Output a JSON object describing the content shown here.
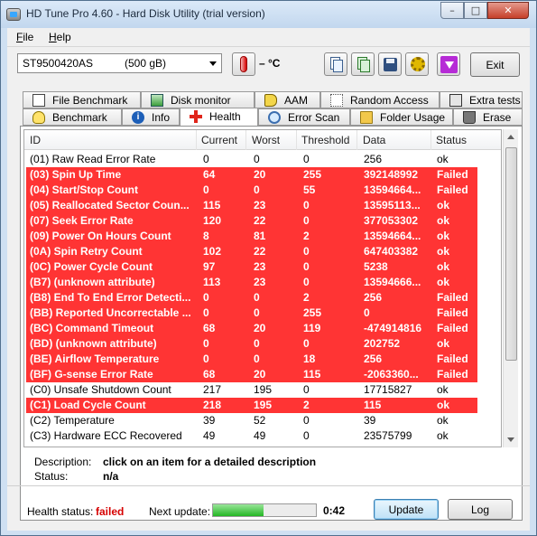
{
  "window": {
    "title": "HD Tune Pro 4.60 - Hard Disk Utility (trial version)",
    "minimize": "–",
    "maximize": "□",
    "close": "✕"
  },
  "menu": [
    {
      "accel": "F",
      "rest": "ile"
    },
    {
      "accel": "H",
      "rest": "elp"
    }
  ],
  "toolbar": {
    "drive_model": "ST9500420AS",
    "drive_size": "(500 gB)",
    "temperature": "– °C",
    "exit_label": "Exit"
  },
  "tabs_top": [
    "File Benchmark",
    "Disk monitor",
    "AAM",
    "Random Access",
    "Extra tests"
  ],
  "tabs_bottom": [
    "Benchmark",
    "Info",
    "Health",
    "Error Scan",
    "Folder Usage",
    "Erase"
  ],
  "active_tab": "Health",
  "table": {
    "columns": [
      "ID",
      "Current",
      "Worst",
      "Threshold",
      "Data",
      "Status"
    ],
    "rows": [
      {
        "id": "(01) Raw Read Error Rate",
        "current": "0",
        "worst": "0",
        "threshold": "0",
        "data": "256",
        "status": "ok",
        "failed": false
      },
      {
        "id": "(03) Spin Up Time",
        "current": "64",
        "worst": "20",
        "threshold": "255",
        "data": "392148992",
        "status": "Failed",
        "failed": true
      },
      {
        "id": "(04) Start/Stop Count",
        "current": "0",
        "worst": "0",
        "threshold": "55",
        "data": "13594664...",
        "status": "Failed",
        "failed": true
      },
      {
        "id": "(05) Reallocated Sector Coun...",
        "current": "115",
        "worst": "23",
        "threshold": "0",
        "data": "13595113...",
        "status": "ok",
        "failed": true
      },
      {
        "id": "(07) Seek Error Rate",
        "current": "120",
        "worst": "22",
        "threshold": "0",
        "data": "377053302",
        "status": "ok",
        "failed": true
      },
      {
        "id": "(09) Power On Hours Count",
        "current": "8",
        "worst": "81",
        "threshold": "2",
        "data": "13594664...",
        "status": "ok",
        "failed": true
      },
      {
        "id": "(0A) Spin Retry Count",
        "current": "102",
        "worst": "22",
        "threshold": "0",
        "data": "647403382",
        "status": "ok",
        "failed": true
      },
      {
        "id": "(0C) Power Cycle Count",
        "current": "97",
        "worst": "23",
        "threshold": "0",
        "data": "5238",
        "status": "ok",
        "failed": true
      },
      {
        "id": "(B7) (unknown attribute)",
        "current": "113",
        "worst": "23",
        "threshold": "0",
        "data": "13594666...",
        "status": "ok",
        "failed": true
      },
      {
        "id": "(B8) End To End Error Detecti...",
        "current": "0",
        "worst": "0",
        "threshold": "2",
        "data": "256",
        "status": "Failed",
        "failed": true
      },
      {
        "id": "(BB) Reported Uncorrectable ...",
        "current": "0",
        "worst": "0",
        "threshold": "255",
        "data": "0",
        "status": "Failed",
        "failed": true
      },
      {
        "id": "(BC) Command Timeout",
        "current": "68",
        "worst": "20",
        "threshold": "119",
        "data": "-474914816",
        "status": "Failed",
        "failed": true
      },
      {
        "id": "(BD) (unknown attribute)",
        "current": "0",
        "worst": "0",
        "threshold": "0",
        "data": "202752",
        "status": "ok",
        "failed": true
      },
      {
        "id": "(BE) Airflow Temperature",
        "current": "0",
        "worst": "0",
        "threshold": "18",
        "data": "256",
        "status": "Failed",
        "failed": true
      },
      {
        "id": "(BF) G-sense Error Rate",
        "current": "68",
        "worst": "20",
        "threshold": "115",
        "data": "-2063360...",
        "status": "Failed",
        "failed": true
      },
      {
        "id": "(C0) Unsafe Shutdown Count",
        "current": "217",
        "worst": "195",
        "threshold": "0",
        "data": "17715827",
        "status": "ok",
        "failed": false
      },
      {
        "id": "(C1) Load Cycle Count",
        "current": "218",
        "worst": "195",
        "threshold": "2",
        "data": "115",
        "status": "ok",
        "failed": true
      },
      {
        "id": "(C2) Temperature",
        "current": "39",
        "worst": "52",
        "threshold": "0",
        "data": "39",
        "status": "ok",
        "failed": false
      },
      {
        "id": "(C3) Hardware ECC Recovered",
        "current": "49",
        "worst": "49",
        "threshold": "0",
        "data": "23575799",
        "status": "ok",
        "failed": false
      }
    ]
  },
  "description": {
    "label": "Description:",
    "text": "click on an item for a detailed description",
    "status_label": "Status:",
    "status_value": "n/a"
  },
  "footer": {
    "health_label": "Health status:",
    "health_value": "failed",
    "next_update_label": "Next update:",
    "progress_fraction": 0.49,
    "countdown": "0:42",
    "update_label": "Update",
    "log_label": "Log"
  },
  "colors": {
    "failed_row": "#ff3434",
    "failed_text": "#d60000"
  }
}
